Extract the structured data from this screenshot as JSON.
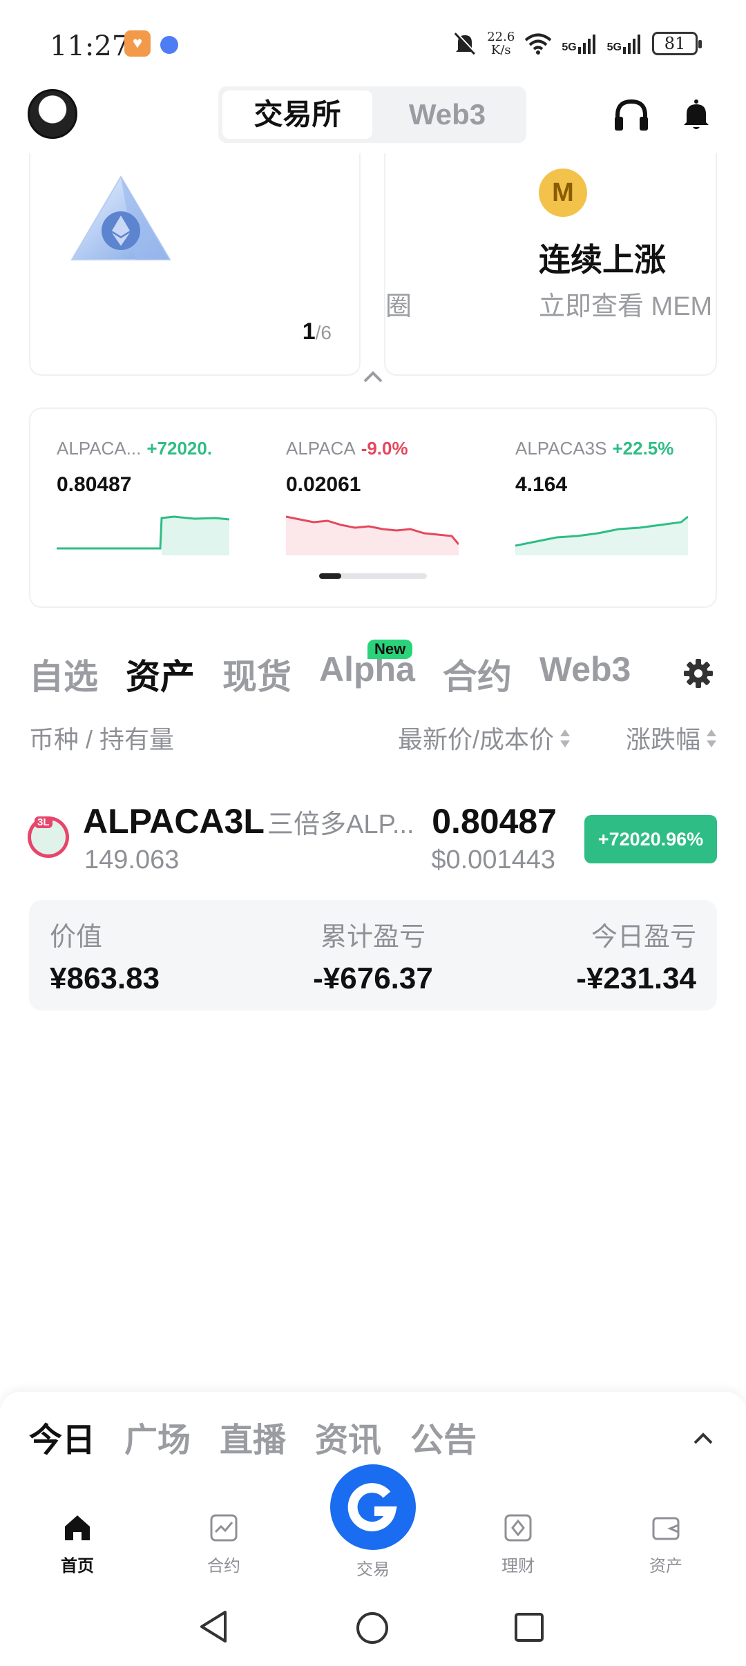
{
  "status_bar": {
    "time": "11:27",
    "net_speed_value": "22.6",
    "net_speed_unit": "K/s",
    "sig1": "5G",
    "sig2": "5G",
    "battery": "81"
  },
  "header": {
    "segments": [
      "交易所",
      "Web3"
    ],
    "active_segment": "交易所"
  },
  "promo": {
    "pager_current": "1",
    "pager_total": "/6",
    "coin_letter": "M",
    "title": "连续上涨",
    "subtitle": "立即查看 MEM",
    "edge_text": "圈"
  },
  "tickers": [
    {
      "name": "ALPACA...",
      "change": "+72020.",
      "price": "0.80487",
      "trend": "up",
      "color": "#2ebd85"
    },
    {
      "name": "ALPACA",
      "change": "-9.0%",
      "price": "0.02061",
      "trend": "down",
      "color": "#e5485d"
    },
    {
      "name": "ALPACA3S",
      "change": "+22.5%",
      "price": "4.164",
      "trend": "up",
      "color": "#2ebd85"
    }
  ],
  "tabs": {
    "items": [
      "自选",
      "资产",
      "现货",
      "Alpha",
      "合约",
      "Web3"
    ],
    "active": "资产",
    "new_badge": "New"
  },
  "columns": {
    "coin": "币种 / 持有量",
    "price": "最新价/成本价",
    "change": "涨跌幅"
  },
  "asset": {
    "icon_label": "3L",
    "symbol": "ALPACA3L",
    "desc": "三倍多ALP...",
    "quantity": "149.063",
    "price": "0.80487",
    "cost": "$0.001443",
    "change": "+72020.96%"
  },
  "summary": {
    "value_label": "价值",
    "value": "¥863.83",
    "pnl_label": "累计盈亏",
    "pnl": "-¥676.37",
    "today_label": "今日盈亏",
    "today": "-¥231.34"
  },
  "news_tabs": {
    "items": [
      "今日",
      "广场",
      "直播",
      "资讯",
      "公告"
    ],
    "active": "今日"
  },
  "bottom_nav": {
    "home": "首页",
    "futures": "合约",
    "trade": "交易",
    "earn": "理财",
    "assets": "资产"
  },
  "colors": {
    "up": "#2ebd85",
    "down": "#e5485d",
    "brand": "#1a6cf0"
  }
}
